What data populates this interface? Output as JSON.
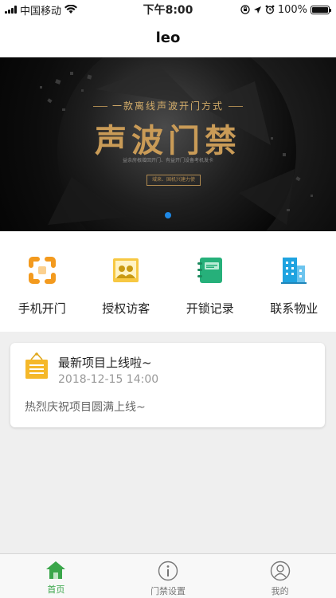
{
  "status_bar": {
    "carrier": "中国移动",
    "time": "下午8:00",
    "battery": "100%",
    "icons": [
      "signal-icon",
      "wifi-icon",
      "lock-rotation-icon",
      "location-icon",
      "alarm-icon",
      "battery-icon"
    ]
  },
  "header": {
    "title": "leo"
  },
  "banner": {
    "slogan": "一款离线声波开门方式",
    "headline": "声波门禁",
    "tagline": "益余房根增回开门、有益开门设备考机发卡",
    "tag": "域来、国机兴建力使",
    "active_slide": 1,
    "slide_count": 1
  },
  "menu": [
    {
      "label": "手机开门",
      "icon": "scan-icon",
      "color": "#f39a1e"
    },
    {
      "label": "授权访客",
      "icon": "visitors-icon",
      "color": "#f2b705"
    },
    {
      "label": "开锁记录",
      "icon": "notebook-icon",
      "color": "#26b07a"
    },
    {
      "label": "联系物业",
      "icon": "building-icon",
      "color": "#1fa3e0"
    }
  ],
  "notice": {
    "icon": "notice-board-icon",
    "title": "最新项目上线啦~",
    "time": "2018-12-15 14:00",
    "body": "热烈庆祝项目圆满上线~"
  },
  "tabs": [
    {
      "label": "首页",
      "icon": "home-icon",
      "active": true
    },
    {
      "label": "门禁设置",
      "icon": "info-icon",
      "active": false
    },
    {
      "label": "我的",
      "icon": "user-icon",
      "active": false
    }
  ],
  "colors": {
    "accent_green": "#3aa64a",
    "banner_gold": "#c99b57",
    "carousel_dot": "#1e88e5"
  }
}
